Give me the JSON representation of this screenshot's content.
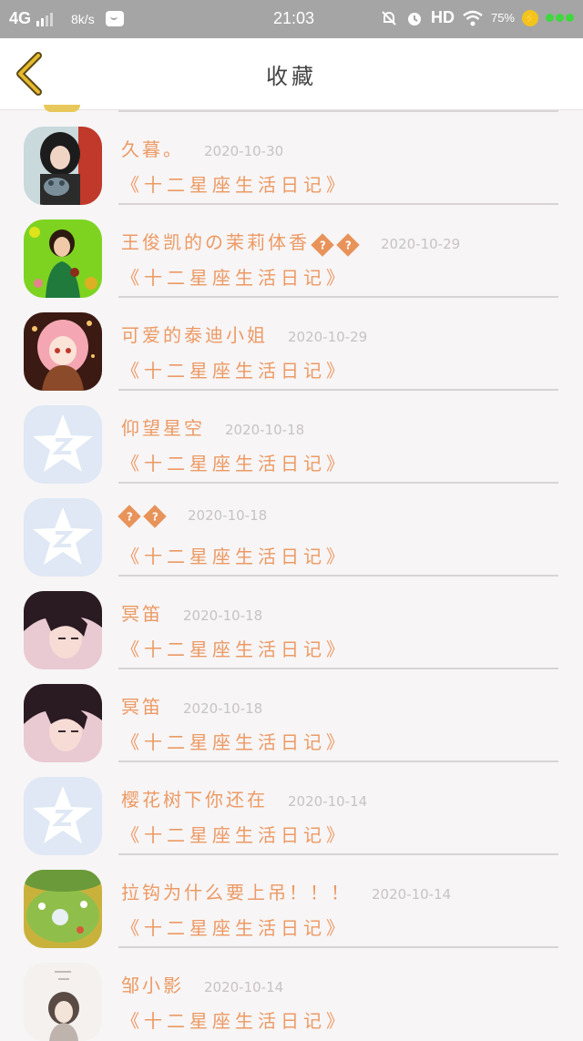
{
  "status_bar": {
    "network": "4G",
    "speed": "8k/s",
    "time": "21:03",
    "hd": "HD",
    "battery_pct": "75%"
  },
  "header": {
    "title": "收藏"
  },
  "favorites": [
    {
      "name": "久暮。",
      "date": "2020-10-30",
      "book": "《十二星座生活日记》",
      "avatar": "photo-dark-hair-girl"
    },
    {
      "name": "王俊凯的の茉莉体香",
      "date": "2020-10-29",
      "book": "《十二星座生活日记》",
      "avatar": "photo-green-girl",
      "badge": "??"
    },
    {
      "name": "可爱的泰迪小姐",
      "date": "2020-10-29",
      "book": "《十二星座生活日记》",
      "avatar": "anime-pink-hair-girl"
    },
    {
      "name": "仰望星空",
      "date": "2020-10-18",
      "book": "《十二星座生活日记》",
      "avatar": "default-qq-star"
    },
    {
      "name": "",
      "date": "2020-10-18",
      "book": "《十二星座生活日记》",
      "avatar": "default-qq-star",
      "badge": "??"
    },
    {
      "name": "冥笛",
      "date": "2020-10-18",
      "book": "《十二星座生活日记》",
      "avatar": "anime-dark-hair-boy"
    },
    {
      "name": "冥笛",
      "date": "2020-10-18",
      "book": "《十二星座生活日记》",
      "avatar": "anime-dark-hair-boy"
    },
    {
      "name": "樱花树下你还在",
      "date": "2020-10-14",
      "book": "《十二星座生活日记》",
      "avatar": "default-qq-star"
    },
    {
      "name": "拉钩为什么要上吊！！！",
      "date": "2020-10-14",
      "book": "《十二星座生活日记》",
      "avatar": "game-scene"
    },
    {
      "name": "邹小影",
      "date": "2020-10-14",
      "book": "《十二星座生活日记》",
      "avatar": "sketch-girl"
    }
  ],
  "colors": {
    "accent": "#ec9a64",
    "date": "#c8c3c4",
    "separator": "#d8d4d5",
    "background": "#f7f5f6",
    "back_arrow": "#e6b92d",
    "default_avatar": "#dfe8f4"
  }
}
